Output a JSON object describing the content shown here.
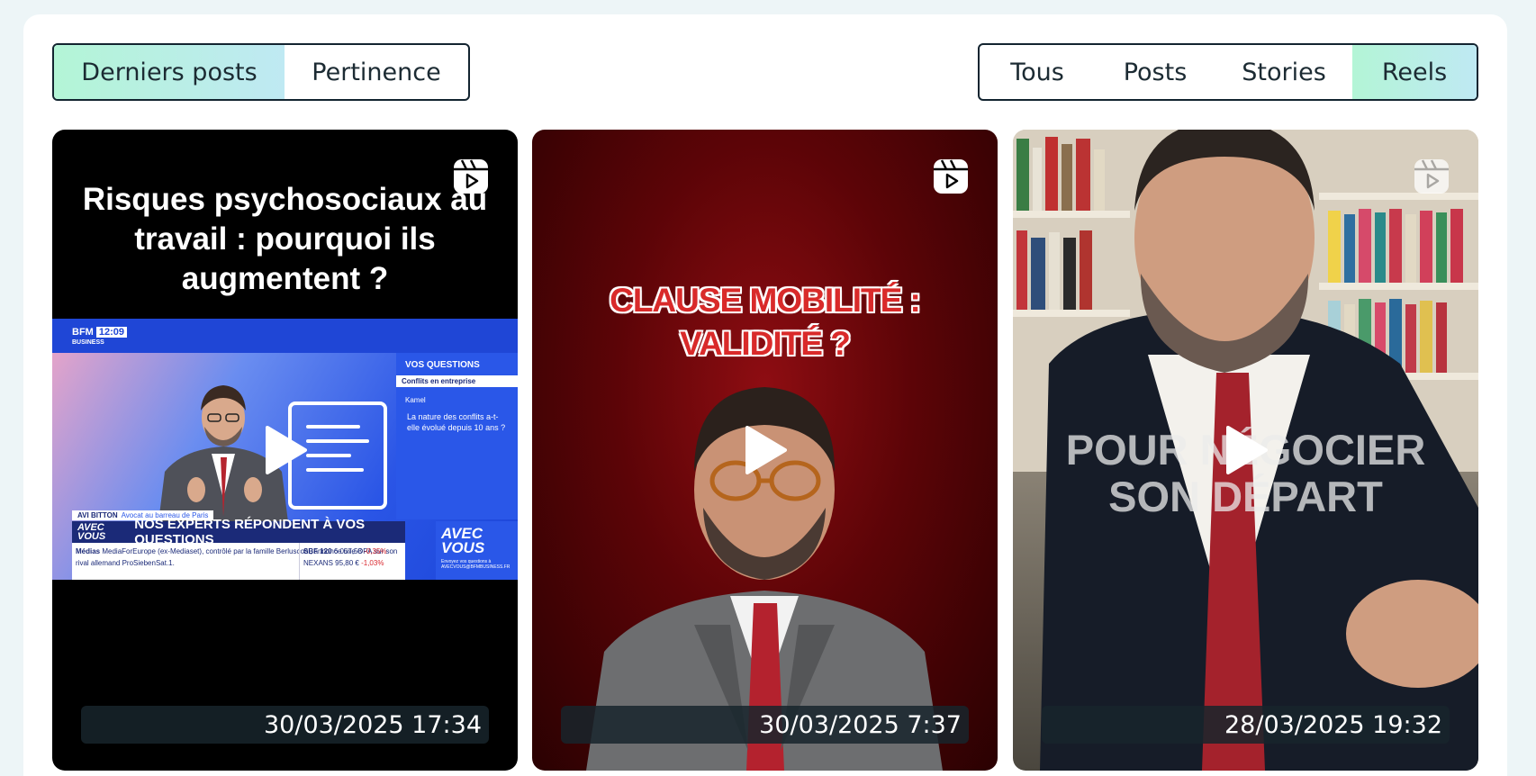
{
  "sort_tabs": [
    {
      "label": "Derniers posts",
      "active": true
    },
    {
      "label": "Pertinence",
      "active": false
    }
  ],
  "type_tabs": [
    {
      "label": "Tous",
      "active": false
    },
    {
      "label": "Posts",
      "active": false
    },
    {
      "label": "Stories",
      "active": false
    },
    {
      "label": "Reels",
      "active": true
    }
  ],
  "colors": {
    "active_gradient_start": "#b3f5d6",
    "active_gradient_end": "#bfe9f3",
    "border": "#132430",
    "page_bg": "#edf5f7"
  },
  "cards": [
    {
      "type_icon": "reel-icon",
      "title": "Risques psychosociaux au travail : pourquoi ils augmentent ?",
      "date": "30/03/2025 17:34",
      "tv": {
        "channel": "BFM",
        "channel_sub": "BUSINESS",
        "clock": "12:09",
        "side_header": "VOS QUESTIONS",
        "side_tab": "Conflits en entreprise",
        "side_name": "Kamel",
        "side_question": "La nature des conflits a-t-elle évolué depuis 10 ans ?",
        "speaker": "AVI BITTON",
        "speaker_role": "Avocat au barreau de Paris",
        "banner_tag": "AVEC VOUS",
        "banner": "NOS EXPERTS RÉPONDENT À VOS QUESTIONS",
        "ticker_label": "Médias",
        "ticker_text": "MediaForEurope (ex-Mediaset), contrôlé par la famille Berlusconi, annonce une OPA sur son rival allemand ProSiebenSat.1.",
        "market_index": "SBF 120",
        "market_value": "6 057,58",
        "market_change": "-0,35%",
        "stock_name": "NEXANS",
        "stock_value": "95,80 €",
        "stock_change": "-1,03%",
        "avec_title": "AVEC VOUS",
        "avec_small": "Envoyez vos questions à AVECVOUS@BFMBUSINESS.FR"
      }
    },
    {
      "type_icon": "reel-icon",
      "title_line1": "CLAUSE MOBILITÉ :",
      "title_line2": "VALIDITÉ ?",
      "date": "30/03/2025 7:37"
    },
    {
      "type_icon": "reel-icon",
      "title_line1": "POUR NÉGOCIER",
      "title_line2": "SON DÉPART",
      "date": "28/03/2025 19:32"
    }
  ]
}
